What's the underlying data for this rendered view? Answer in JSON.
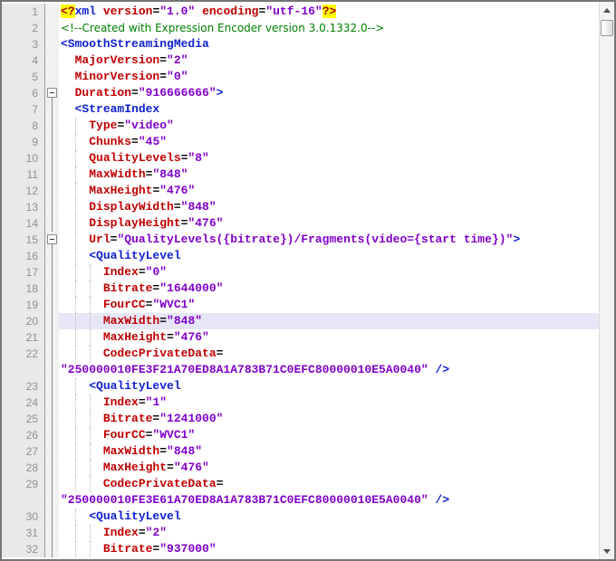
{
  "app": {
    "title": "XML manifest editor view",
    "language": "xml",
    "caret_line": 20
  },
  "colors": {
    "tag": "#1021d0",
    "attr": "#c00000",
    "val": "#8000c8",
    "decl_fg": "#b00000",
    "decl_bg": "#ffff00",
    "comment": "#008000",
    "caret_line": "#e6e6f6",
    "margin_bg": "#e9e9e9",
    "margin_border": "#9c9c9c",
    "line_number": "#8a8f96"
  },
  "scrollbar": {
    "up_icon": "scroll-up-icon",
    "down_icon": "scroll-down-icon",
    "thumb_position": "top"
  },
  "editor": {
    "lines": [
      {
        "n": "1",
        "fold": "",
        "caret": false,
        "guides": [],
        "seg": [
          [
            "decl",
            "<?"
          ],
          [
            "tag",
            "xml"
          ],
          [
            "plain",
            " "
          ],
          [
            "attr",
            "version"
          ],
          [
            "plain",
            "="
          ],
          [
            "val",
            "\"1.0\""
          ],
          [
            "plain",
            " "
          ],
          [
            "attr",
            "encoding"
          ],
          [
            "plain",
            "="
          ],
          [
            "val",
            "\"utf-16\""
          ],
          [
            "decl",
            "?>"
          ]
        ]
      },
      {
        "n": "2",
        "fold": "",
        "caret": false,
        "guides": [],
        "seg": [
          [
            "comment",
            "<!--Created with Expression Encoder version 3.0.1332.0-->"
          ]
        ]
      },
      {
        "n": "3",
        "fold": "",
        "caret": false,
        "guides": [],
        "seg": [
          [
            "tag",
            "<SmoothStreamingMedia"
          ]
        ]
      },
      {
        "n": "4",
        "fold": "",
        "caret": false,
        "guides": [],
        "seg": [
          [
            "plain",
            "  "
          ],
          [
            "attr",
            "MajorVersion"
          ],
          [
            "plain",
            "="
          ],
          [
            "val",
            "\"2\""
          ]
        ]
      },
      {
        "n": "5",
        "fold": "",
        "caret": false,
        "guides": [],
        "seg": [
          [
            "plain",
            "  "
          ],
          [
            "attr",
            "MinorVersion"
          ],
          [
            "plain",
            "="
          ],
          [
            "val",
            "\"0\""
          ]
        ]
      },
      {
        "n": "6",
        "fold": "box",
        "caret": false,
        "guides": [],
        "seg": [
          [
            "plain",
            "  "
          ],
          [
            "attr",
            "Duration"
          ],
          [
            "plain",
            "="
          ],
          [
            "val",
            "\"916666666\""
          ],
          [
            "tag",
            ">"
          ]
        ]
      },
      {
        "n": "7",
        "fold": "line",
        "caret": false,
        "guides": [],
        "seg": [
          [
            "plain",
            "  "
          ],
          [
            "tag",
            "<StreamIndex"
          ]
        ]
      },
      {
        "n": "8",
        "fold": "line",
        "caret": false,
        "guides": [
          18
        ],
        "seg": [
          [
            "plain",
            "    "
          ],
          [
            "attr",
            "Type"
          ],
          [
            "plain",
            "="
          ],
          [
            "val",
            "\"video\""
          ]
        ]
      },
      {
        "n": "9",
        "fold": "line",
        "caret": false,
        "guides": [
          18
        ],
        "seg": [
          [
            "plain",
            "    "
          ],
          [
            "attr",
            "Chunks"
          ],
          [
            "plain",
            "="
          ],
          [
            "val",
            "\"45\""
          ]
        ]
      },
      {
        "n": "10",
        "fold": "line",
        "caret": false,
        "guides": [
          18
        ],
        "seg": [
          [
            "plain",
            "    "
          ],
          [
            "attr",
            "QualityLevels"
          ],
          [
            "plain",
            "="
          ],
          [
            "val",
            "\"8\""
          ]
        ]
      },
      {
        "n": "11",
        "fold": "line",
        "caret": false,
        "guides": [
          18
        ],
        "seg": [
          [
            "plain",
            "    "
          ],
          [
            "attr",
            "MaxWidth"
          ],
          [
            "plain",
            "="
          ],
          [
            "val",
            "\"848\""
          ]
        ]
      },
      {
        "n": "12",
        "fold": "line",
        "caret": false,
        "guides": [
          18
        ],
        "seg": [
          [
            "plain",
            "    "
          ],
          [
            "attr",
            "MaxHeight"
          ],
          [
            "plain",
            "="
          ],
          [
            "val",
            "\"476\""
          ]
        ]
      },
      {
        "n": "13",
        "fold": "line",
        "caret": false,
        "guides": [
          18
        ],
        "seg": [
          [
            "plain",
            "    "
          ],
          [
            "attr",
            "DisplayWidth"
          ],
          [
            "plain",
            "="
          ],
          [
            "val",
            "\"848\""
          ]
        ]
      },
      {
        "n": "14",
        "fold": "line",
        "caret": false,
        "guides": [
          18
        ],
        "seg": [
          [
            "plain",
            "    "
          ],
          [
            "attr",
            "DisplayHeight"
          ],
          [
            "plain",
            "="
          ],
          [
            "val",
            "\"476\""
          ]
        ]
      },
      {
        "n": "15",
        "fold": "box",
        "caret": false,
        "guides": [
          18
        ],
        "seg": [
          [
            "plain",
            "    "
          ],
          [
            "attr",
            "Url"
          ],
          [
            "plain",
            "="
          ],
          [
            "val",
            "\"QualityLevels({bitrate})/Fragments(video={start time})\""
          ],
          [
            "tag",
            ">"
          ]
        ]
      },
      {
        "n": "16",
        "fold": "line",
        "caret": false,
        "guides": [
          18
        ],
        "seg": [
          [
            "plain",
            "    "
          ],
          [
            "tag",
            "<QualityLevel"
          ]
        ]
      },
      {
        "n": "17",
        "fold": "line",
        "caret": false,
        "guides": [
          18,
          34
        ],
        "seg": [
          [
            "plain",
            "      "
          ],
          [
            "attr",
            "Index"
          ],
          [
            "plain",
            "="
          ],
          [
            "val",
            "\"0\""
          ]
        ]
      },
      {
        "n": "18",
        "fold": "line",
        "caret": false,
        "guides": [
          18,
          34
        ],
        "seg": [
          [
            "plain",
            "      "
          ],
          [
            "attr",
            "Bitrate"
          ],
          [
            "plain",
            "="
          ],
          [
            "val",
            "\"1644000\""
          ]
        ]
      },
      {
        "n": "19",
        "fold": "line",
        "caret": false,
        "guides": [
          18,
          34
        ],
        "seg": [
          [
            "plain",
            "      "
          ],
          [
            "attr",
            "FourCC"
          ],
          [
            "plain",
            "="
          ],
          [
            "val",
            "\"WVC1\""
          ]
        ]
      },
      {
        "n": "20",
        "fold": "line",
        "caret": true,
        "guides": [
          18,
          34
        ],
        "seg": [
          [
            "plain",
            "      "
          ],
          [
            "attr",
            "MaxWidth"
          ],
          [
            "plain",
            "="
          ],
          [
            "val",
            "\"848\""
          ]
        ]
      },
      {
        "n": "21",
        "fold": "line",
        "caret": false,
        "guides": [
          18,
          34
        ],
        "seg": [
          [
            "plain",
            "      "
          ],
          [
            "attr",
            "MaxHeight"
          ],
          [
            "plain",
            "="
          ],
          [
            "val",
            "\"476\""
          ]
        ]
      },
      {
        "n": "22",
        "fold": "line",
        "caret": false,
        "guides": [
          18,
          34
        ],
        "seg": [
          [
            "plain",
            "      "
          ],
          [
            "attr",
            "CodecPrivateData"
          ],
          [
            "plain",
            "="
          ]
        ]
      },
      {
        "n": "",
        "fold": "line",
        "caret": false,
        "guides": [],
        "seg": [
          [
            "val",
            "\"250000010FE3F21A70ED8A1A783B71C0EFC80000010E5A0040\""
          ],
          [
            "plain",
            " "
          ],
          [
            "tag",
            "/>"
          ]
        ]
      },
      {
        "n": "23",
        "fold": "line",
        "caret": false,
        "guides": [
          18
        ],
        "seg": [
          [
            "plain",
            "    "
          ],
          [
            "tag",
            "<QualityLevel"
          ]
        ]
      },
      {
        "n": "24",
        "fold": "line",
        "caret": false,
        "guides": [
          18,
          34
        ],
        "seg": [
          [
            "plain",
            "      "
          ],
          [
            "attr",
            "Index"
          ],
          [
            "plain",
            "="
          ],
          [
            "val",
            "\"1\""
          ]
        ]
      },
      {
        "n": "25",
        "fold": "line",
        "caret": false,
        "guides": [
          18,
          34
        ],
        "seg": [
          [
            "plain",
            "      "
          ],
          [
            "attr",
            "Bitrate"
          ],
          [
            "plain",
            "="
          ],
          [
            "val",
            "\"1241000\""
          ]
        ]
      },
      {
        "n": "26",
        "fold": "line",
        "caret": false,
        "guides": [
          18,
          34
        ],
        "seg": [
          [
            "plain",
            "      "
          ],
          [
            "attr",
            "FourCC"
          ],
          [
            "plain",
            "="
          ],
          [
            "val",
            "\"WVC1\""
          ]
        ]
      },
      {
        "n": "27",
        "fold": "line",
        "caret": false,
        "guides": [
          18,
          34
        ],
        "seg": [
          [
            "plain",
            "      "
          ],
          [
            "attr",
            "MaxWidth"
          ],
          [
            "plain",
            "="
          ],
          [
            "val",
            "\"848\""
          ]
        ]
      },
      {
        "n": "28",
        "fold": "line",
        "caret": false,
        "guides": [
          18,
          34
        ],
        "seg": [
          [
            "plain",
            "      "
          ],
          [
            "attr",
            "MaxHeight"
          ],
          [
            "plain",
            "="
          ],
          [
            "val",
            "\"476\""
          ]
        ]
      },
      {
        "n": "29",
        "fold": "line",
        "caret": false,
        "guides": [
          18,
          34
        ],
        "seg": [
          [
            "plain",
            "      "
          ],
          [
            "attr",
            "CodecPrivateData"
          ],
          [
            "plain",
            "="
          ]
        ]
      },
      {
        "n": "",
        "fold": "line",
        "caret": false,
        "guides": [],
        "seg": [
          [
            "val",
            "\"250000010FE3E61A70ED8A1A783B71C0EFC80000010E5A0040\""
          ],
          [
            "plain",
            " "
          ],
          [
            "tag",
            "/>"
          ]
        ]
      },
      {
        "n": "30",
        "fold": "line",
        "caret": false,
        "guides": [
          18
        ],
        "seg": [
          [
            "plain",
            "    "
          ],
          [
            "tag",
            "<QualityLevel"
          ]
        ]
      },
      {
        "n": "31",
        "fold": "line",
        "caret": false,
        "guides": [
          18,
          34
        ],
        "seg": [
          [
            "plain",
            "      "
          ],
          [
            "attr",
            "Index"
          ],
          [
            "plain",
            "="
          ],
          [
            "val",
            "\"2\""
          ]
        ]
      },
      {
        "n": "32",
        "fold": "line",
        "caret": false,
        "guides": [
          18,
          34
        ],
        "seg": [
          [
            "plain",
            "      "
          ],
          [
            "attr",
            "Bitrate"
          ],
          [
            "plain",
            "="
          ],
          [
            "val",
            "\"937000\""
          ]
        ]
      }
    ]
  }
}
